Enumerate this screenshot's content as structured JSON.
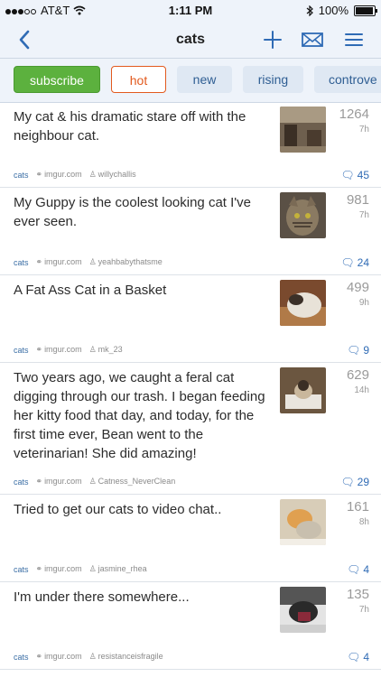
{
  "status": {
    "carrier": "AT&T",
    "time": "1:11 PM",
    "battery": "100%"
  },
  "nav": {
    "title": "cats"
  },
  "sort": {
    "subscribe": "subscribe",
    "hot": "hot",
    "new": "new",
    "rising": "rising",
    "controversial": "controve"
  },
  "posts": [
    {
      "title": "My cat & his dramatic stare off with the neighbour cat.",
      "score": "1264",
      "age": "7h",
      "subreddit": "cats",
      "domain": "imgur.com",
      "author": "willychallis",
      "comments": "45"
    },
    {
      "title": "My Guppy is the coolest looking cat I've ever seen.",
      "score": "981",
      "age": "7h",
      "subreddit": "cats",
      "domain": "imgur.com",
      "author": "yeahbabythatsme",
      "comments": "24"
    },
    {
      "title": "A Fat Ass Cat in a Basket",
      "score": "499",
      "age": "9h",
      "subreddit": "cats",
      "domain": "imgur.com",
      "author": "mk_23",
      "comments": "9"
    },
    {
      "title": "Two years ago, we caught a feral cat digging through our trash. I began feeding her kitty food that day, and today, for the first time ever, Bean went to the veterinarian! She did amazing!",
      "score": "629",
      "age": "14h",
      "subreddit": "cats",
      "domain": "imgur.com",
      "author": "Catness_NeverClean",
      "comments": "29"
    },
    {
      "title": "Tried to get our cats to video chat..",
      "score": "161",
      "age": "8h",
      "subreddit": "cats",
      "domain": "imgur.com",
      "author": "jasmine_rhea",
      "comments": "4"
    },
    {
      "title": "I'm under there somewhere...",
      "score": "135",
      "age": "7h",
      "subreddit": "cats",
      "domain": "imgur.com",
      "author": "resistanceisfragile",
      "comments": "4"
    }
  ]
}
